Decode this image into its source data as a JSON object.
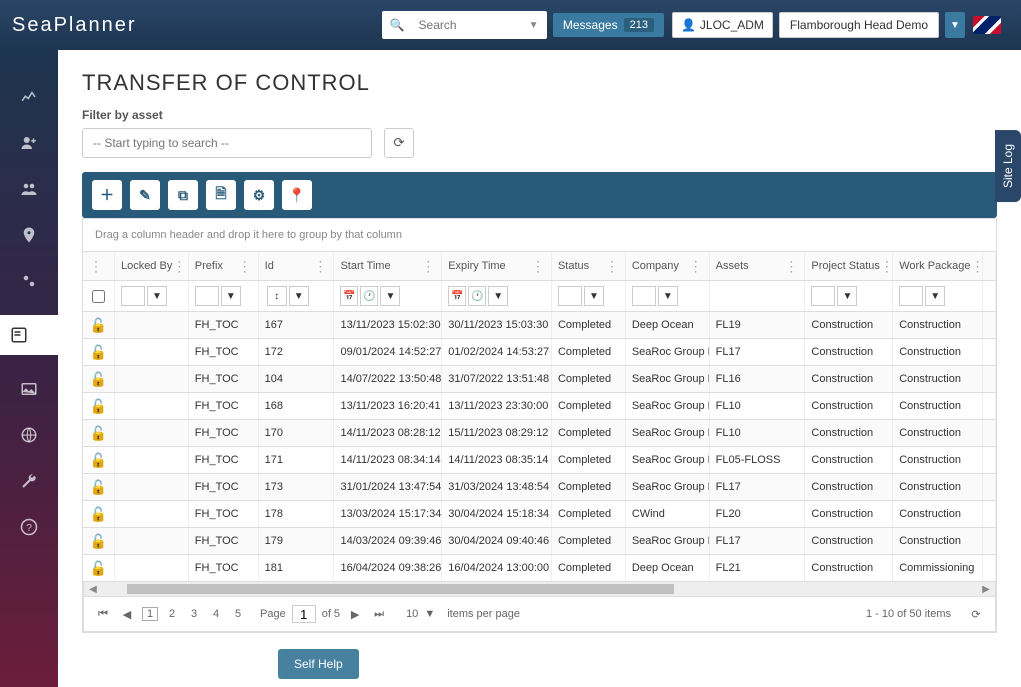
{
  "header": {
    "logo": "SeaPlanner",
    "search_placeholder": "Search",
    "messages_label": "Messages",
    "messages_count": "213",
    "user": "JLOC_ADM",
    "site": "Flamborough Head Demo"
  },
  "page": {
    "title": "TRANSFER OF CONTROL",
    "filter_label": "Filter by asset",
    "filter_placeholder": "-- Start typing to search --",
    "group_hint": "Drag a column header and drop it here to group by that column"
  },
  "columns": [
    "",
    "Locked By",
    "Prefix",
    "Id",
    "Start Time",
    "Expiry Time",
    "Status",
    "Company",
    "Assets",
    "Project Status",
    "Work Package",
    ""
  ],
  "rows": [
    {
      "prefix": "FH_TOC",
      "id": "167",
      "start": "13/11/2023 15:02:30",
      "expiry": "30/11/2023 15:03:30",
      "status": "Completed",
      "company": "Deep Ocean",
      "assets": "FL19",
      "ps": "Construction",
      "wp": "Construction"
    },
    {
      "prefix": "FH_TOC",
      "id": "172",
      "start": "09/01/2024 14:52:27",
      "expiry": "01/02/2024 14:53:27",
      "status": "Completed",
      "company": "SeaRoc Group Ltd",
      "assets": "FL17",
      "ps": "Construction",
      "wp": "Construction"
    },
    {
      "prefix": "FH_TOC",
      "id": "104",
      "start": "14/07/2022 13:50:48",
      "expiry": "31/07/2022 13:51:48",
      "status": "Completed",
      "company": "SeaRoc Group Ltd",
      "assets": "FL16",
      "ps": "Construction",
      "wp": "Construction"
    },
    {
      "prefix": "FH_TOC",
      "id": "168",
      "start": "13/11/2023 16:20:41",
      "expiry": "13/11/2023 23:30:00",
      "status": "Completed",
      "company": "SeaRoc Group Ltd",
      "assets": "FL10",
      "ps": "Construction",
      "wp": "Construction"
    },
    {
      "prefix": "FH_TOC",
      "id": "170",
      "start": "14/11/2023 08:28:12",
      "expiry": "15/11/2023 08:29:12",
      "status": "Completed",
      "company": "SeaRoc Group Ltd",
      "assets": "FL10",
      "ps": "Construction",
      "wp": "Construction"
    },
    {
      "prefix": "FH_TOC",
      "id": "171",
      "start": "14/11/2023 08:34:14",
      "expiry": "14/11/2023 08:35:14",
      "status": "Completed",
      "company": "SeaRoc Group Ltd",
      "assets": "FL05-FLOSS",
      "ps": "Construction",
      "wp": "Construction"
    },
    {
      "prefix": "FH_TOC",
      "id": "173",
      "start": "31/01/2024 13:47:54",
      "expiry": "31/03/2024 13:48:54",
      "status": "Completed",
      "company": "SeaRoc Group Ltd",
      "assets": "FL17",
      "ps": "Construction",
      "wp": "Construction"
    },
    {
      "prefix": "FH_TOC",
      "id": "178",
      "start": "13/03/2024 15:17:34",
      "expiry": "30/04/2024 15:18:34",
      "status": "Completed",
      "company": "CWind",
      "assets": "FL20",
      "ps": "Construction",
      "wp": "Construction"
    },
    {
      "prefix": "FH_TOC",
      "id": "179",
      "start": "14/03/2024 09:39:46",
      "expiry": "30/04/2024 09:40:46",
      "status": "Completed",
      "company": "SeaRoc Group Ltd",
      "assets": "FL17",
      "ps": "Construction",
      "wp": "Construction"
    },
    {
      "prefix": "FH_TOC",
      "id": "181",
      "start": "16/04/2024 09:38:26",
      "expiry": "16/04/2024 13:00:00",
      "status": "Completed",
      "company": "Deep Ocean",
      "assets": "FL21",
      "ps": "Construction",
      "wp": "Commissioning"
    }
  ],
  "pager": {
    "pages": [
      "1",
      "2",
      "3",
      "4",
      "5"
    ],
    "page_label": "Page",
    "current": "1",
    "of_label": "of 5",
    "size": "10",
    "per_page": "items per page",
    "summary": "1 - 10 of 50 items"
  },
  "self_help": "Self Help",
  "site_log": "Site Log"
}
